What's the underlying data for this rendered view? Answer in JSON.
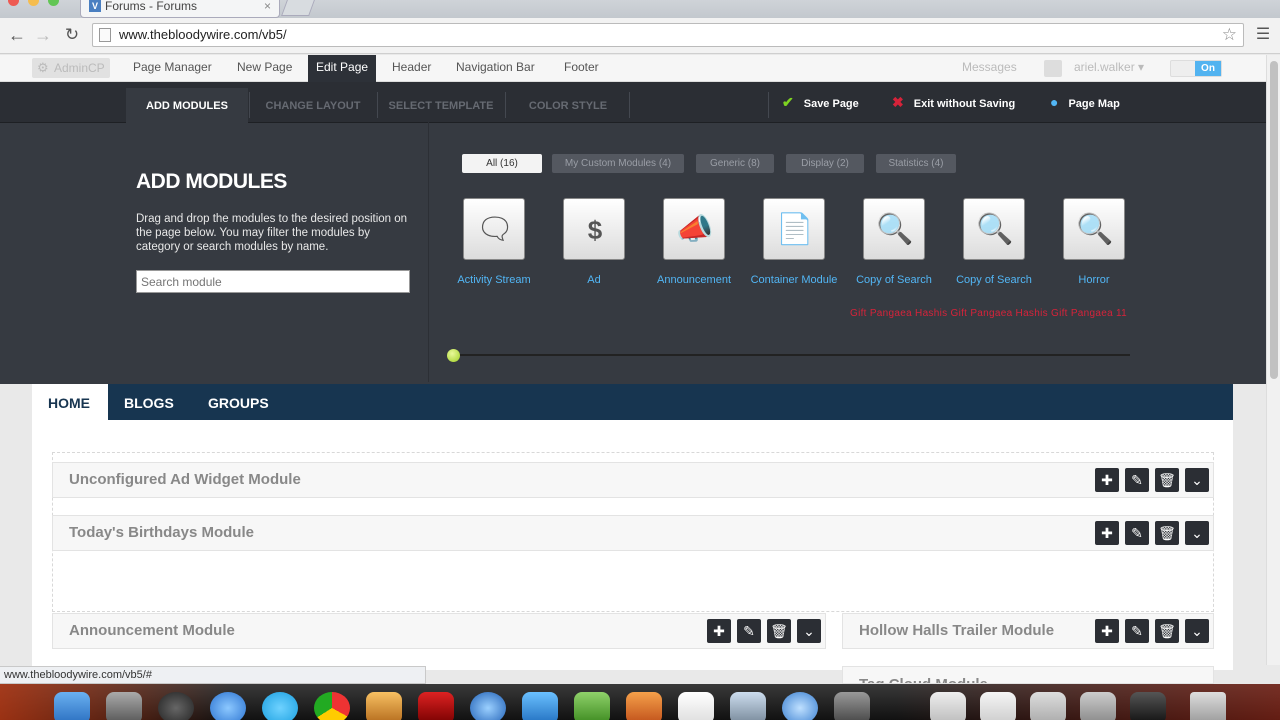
{
  "browser": {
    "tab_title": "Forums - Forums",
    "tab_close": "×",
    "url": "www.thebloodywire.com/vb5/",
    "status_url": "www.thebloodywire.com/vb5/#"
  },
  "adminbar": {
    "admincp": "AdminCP",
    "items": [
      "Page Manager",
      "New Page",
      "Edit Page",
      "Header",
      "Navigation Bar",
      "Footer"
    ],
    "active_item": "Edit Page",
    "messages": "Messages",
    "username": "ariel.walker ▾",
    "toggle": "On"
  },
  "editor": {
    "subtabs": [
      "ADD MODULES",
      "CHANGE LAYOUT",
      "SELECT TEMPLATE",
      "COLOR STYLE"
    ],
    "actions": {
      "save": "Save Page",
      "exit": "Exit without Saving",
      "map": "Page Map"
    },
    "title": "ADD MODULES",
    "description": "Drag and drop the modules to the desired position on the page below. You may filter the modules by category or search modules by name.",
    "search_placeholder": "Search module",
    "filters": [
      "All (16)",
      "My Custom Modules (4)",
      "Generic (8)",
      "Display (2)",
      "Statistics (4)"
    ],
    "modules": [
      {
        "label": "Activity Stream",
        "icon": "speech-bubbles-icon"
      },
      {
        "label": "Ad",
        "icon": "money-bag-icon"
      },
      {
        "label": "Announcement",
        "icon": "megaphone-icon"
      },
      {
        "label": "Container Module",
        "icon": "document-icon"
      },
      {
        "label": "Copy of Search",
        "icon": "magnifier-icon"
      },
      {
        "label": "Copy of Search",
        "icon": "magnifier-icon"
      },
      {
        "label": "Horror",
        "icon": "magnifier-icon"
      }
    ],
    "red_note": "Gift Pangaea Hashis Gift Pangaea Hashis Gift Pangaea 11"
  },
  "sitenav": {
    "tabs": [
      "HOME",
      "BLOGS",
      "GROUPS"
    ]
  },
  "page_modules": [
    "Unconfigured Ad Widget Module",
    "Today's Birthdays Module",
    "Announcement Module",
    "Hollow Halls Trailer Module",
    "Tag Cloud Module"
  ],
  "colors": {
    "editor_bg": "#363a41",
    "nav_blue": "#173550",
    "accent_blue": "#52b6f5",
    "save_green": "#7ed321",
    "exit_red": "#d6233a"
  }
}
